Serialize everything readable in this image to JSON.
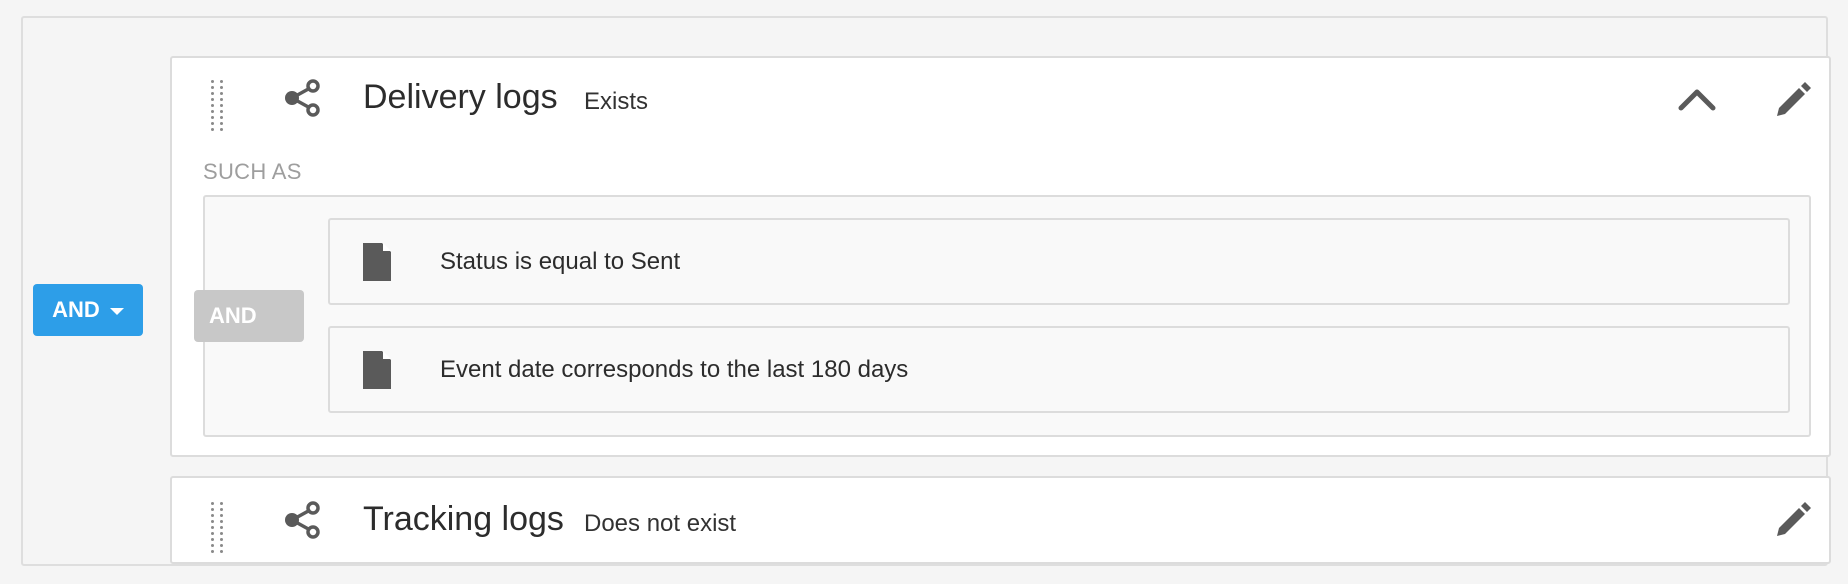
{
  "root_operator": {
    "label": "AND",
    "icon": "chevron-down-icon"
  },
  "blocks": [
    {
      "title": "Delivery logs",
      "status": "Exists",
      "icons": [
        "drag-handle-icon",
        "share-icon",
        "chevron-up-icon",
        "pencil-icon"
      ],
      "section_label": "SUCH AS",
      "inner_operator": "AND",
      "conditions": [
        {
          "text": "Status is equal to Sent",
          "icon": "document-icon"
        },
        {
          "text": "Event date corresponds to the last 180 days",
          "icon": "document-icon"
        }
      ]
    },
    {
      "title": "Tracking logs",
      "status": "Does not exist",
      "icons": [
        "drag-handle-icon",
        "share-icon",
        "pencil-icon"
      ]
    }
  ],
  "colors": {
    "accent": "#2d9ee8",
    "disabled_operator": "#c8c8c8",
    "icon": "#5a5a5a",
    "border": "#dcdcdc"
  }
}
